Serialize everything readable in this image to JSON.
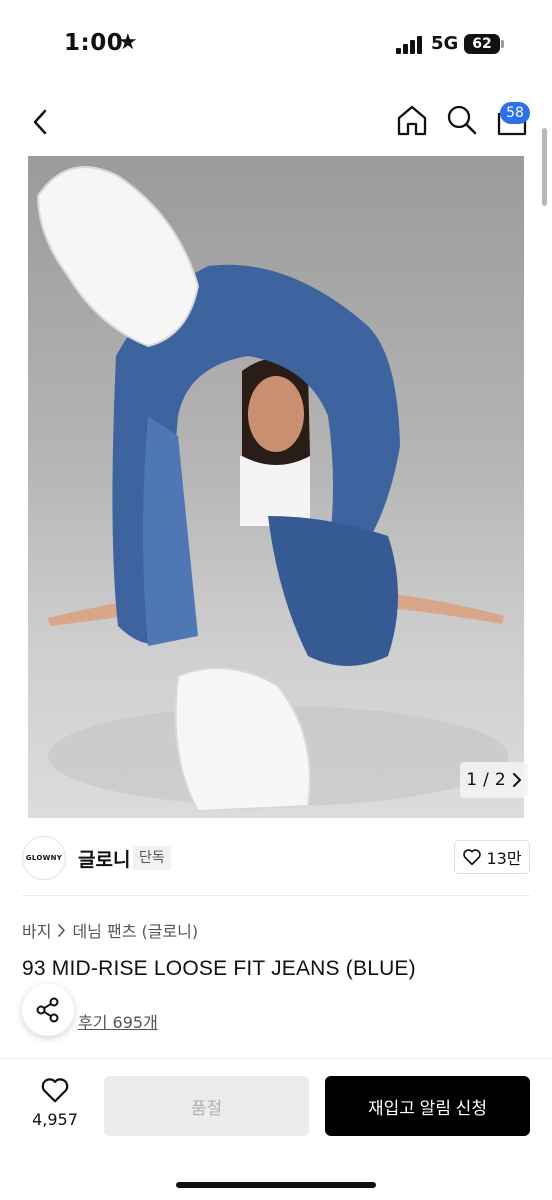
{
  "status_bar": {
    "time": "1:00",
    "network": "5G",
    "battery": "62"
  },
  "header": {
    "cart_count": "58"
  },
  "gallery": {
    "current": "1",
    "separator": "/",
    "total": "2",
    "colors": {
      "background": "#a8a8a8",
      "denim": "#3e64a0"
    }
  },
  "brand": {
    "logo_text": "GLOWNY",
    "name": "글로니",
    "badge": "단독",
    "likes": "13만"
  },
  "breadcrumb": {
    "category": "바지",
    "subcategory": "데님 팬츠 (글로니)"
  },
  "product": {
    "title": "93 MID-RISE LOOSE FIT JEANS (BLUE)",
    "review_text": "후기 695개"
  },
  "bottom_bar": {
    "wish_count": "4,957",
    "soldout_label": "품절",
    "restock_label": "재입고 알림 신청"
  },
  "colors": {
    "accent": "#2f6fea",
    "primary_button": "#000000",
    "disabled_button": "#ececec"
  }
}
